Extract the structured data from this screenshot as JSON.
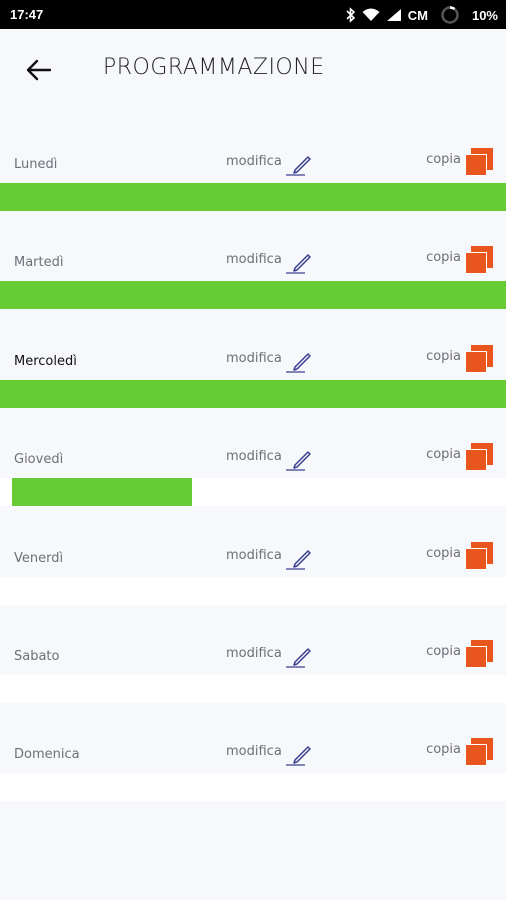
{
  "status_bar": {
    "time": "17:47",
    "carrier": "CM",
    "battery": "10%",
    "icons": [
      "bluetooth-icon",
      "wifi-icon",
      "signal-icon",
      "battery-ring-icon"
    ]
  },
  "header": {
    "title": "PROGRAMMAZIONE",
    "back_icon": "arrow-left-icon"
  },
  "labels": {
    "edit": "modifica",
    "copy": "copia"
  },
  "colors": {
    "fill_green": "#65cc33",
    "copy_orange": "#e8561e",
    "pencil": "#3b3f8f"
  },
  "days": [
    {
      "name": "Lunedì",
      "bar": {
        "start": 0,
        "end": 1
      },
      "active": false
    },
    {
      "name": "Martedì",
      "bar": {
        "start": 0,
        "end": 1
      },
      "active": false
    },
    {
      "name": "Mercoledì",
      "bar": {
        "start": 0,
        "end": 1
      },
      "active": true
    },
    {
      "name": "Giovedì",
      "bar": {
        "start": 0.024,
        "end": 0.379
      },
      "active": false
    },
    {
      "name": "Venerdì",
      "bar": null,
      "active": false
    },
    {
      "name": "Sabato",
      "bar": null,
      "active": false
    },
    {
      "name": "Domenica",
      "bar": null,
      "active": false
    }
  ]
}
